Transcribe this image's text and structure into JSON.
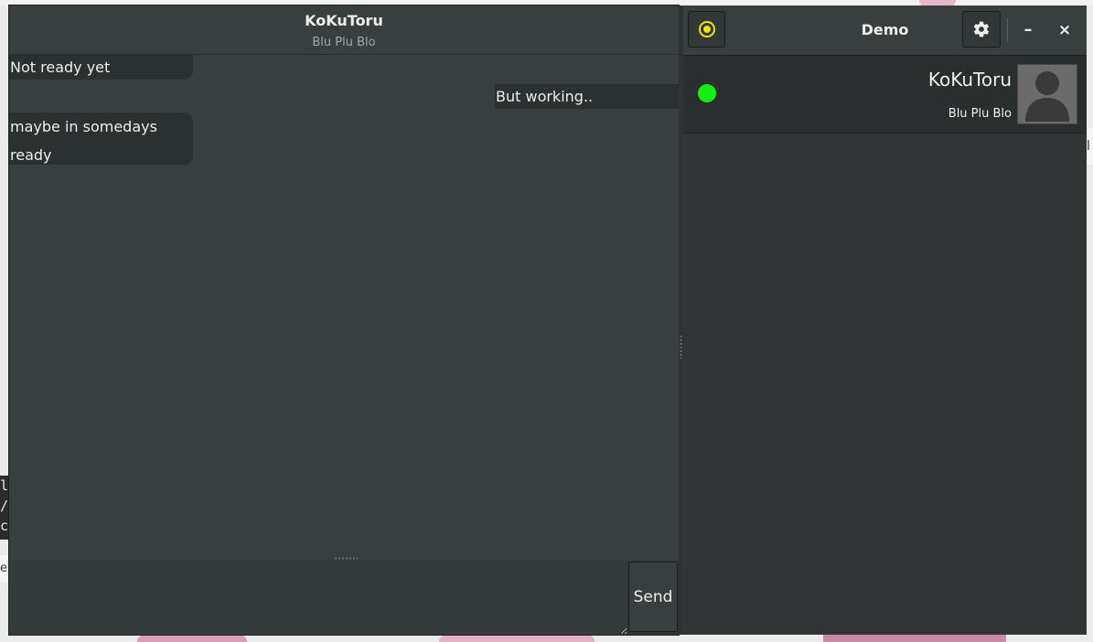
{
  "chat": {
    "title": "KoKuToru",
    "subtitle": "Blu Plu Blo",
    "messages": [
      {
        "side": "left",
        "text": "Not ready yet"
      },
      {
        "side": "right",
        "text": "But working.."
      },
      {
        "side": "left",
        "lines": [
          "maybe in somedays",
          "ready"
        ]
      }
    ],
    "input": {
      "value": "",
      "placeholder": ""
    },
    "send_label": "Send"
  },
  "contacts": {
    "title": "Demo",
    "status_icon": "status-indicator-icon",
    "status_color": "#f2e409",
    "settings_icon": "gear-icon",
    "minimize_label": "–",
    "close_label": "×",
    "items": [
      {
        "name": "KoKuToru",
        "status": "Blu Plu Blo",
        "presence_color": "#14ef0f",
        "avatar_icon": "avatar-placeholder-icon"
      }
    ]
  },
  "desktop": {
    "terminal_lines": [
      "l",
      "/",
      "c"
    ],
    "background_text": "er",
    "right_edge_text": "l"
  }
}
